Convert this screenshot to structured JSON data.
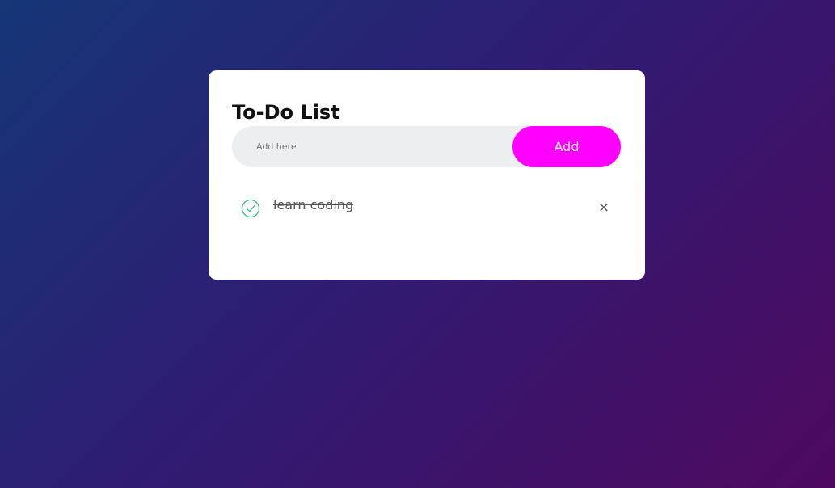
{
  "app": {
    "title": "To-Do List"
  },
  "input": {
    "placeholder": "Add here",
    "value": ""
  },
  "add_button": {
    "label": "Add"
  },
  "tasks": [
    {
      "text": "learn coding",
      "checked": true,
      "close_symbol": "×"
    }
  ],
  "icons": {
    "check": "check-circle-icon",
    "close": "close-icon"
  },
  "colors": {
    "accent": "#ff00ff",
    "check": "#3bba7a",
    "background_start": "#153677",
    "background_end": "#4e085f"
  }
}
